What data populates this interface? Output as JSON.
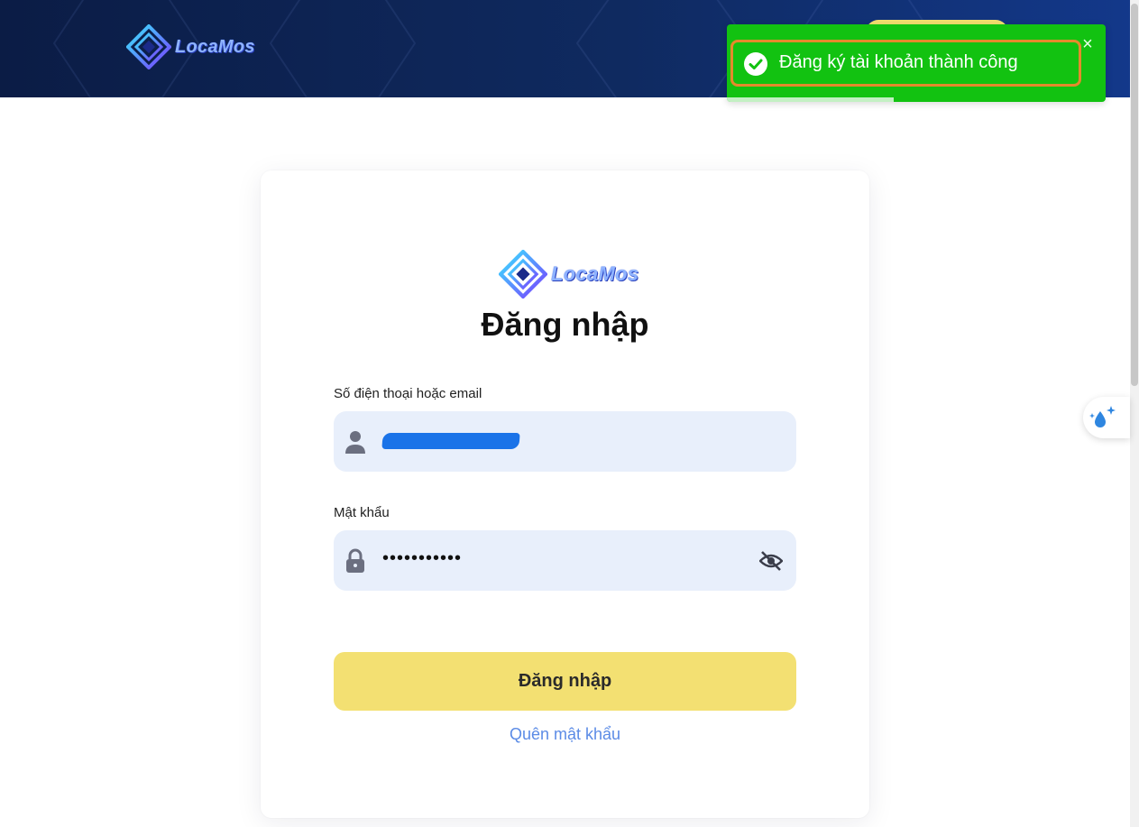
{
  "header": {
    "brand": "LocaMos"
  },
  "toast": {
    "message": "Đăng ký tài khoản thành công",
    "close_label": "×",
    "progress": 0.44
  },
  "login": {
    "brand": "LocaMos",
    "title": "Đăng nhập",
    "phone_label": "Số điện thoại hoặc email",
    "password_label": "Mật khẩu",
    "password_value": "•••••••••••",
    "submit_label": "Đăng nhập",
    "forgot_label": "Quên mật khẩu"
  },
  "icons": {
    "toast": "check-circle-icon",
    "user": "user-icon",
    "lock": "lock-icon",
    "eye": "eye-off-icon",
    "side": "sparkle-drop-icon",
    "logo": "locamos-logo-icon"
  },
  "colors": {
    "header": "#0f2a60",
    "toast": "#12c211",
    "toast_highlight": "#e48a2c",
    "input_bg": "#e8effb",
    "button": "#f3e072",
    "link": "#5b8be6",
    "redaction": "#1a73e8"
  }
}
